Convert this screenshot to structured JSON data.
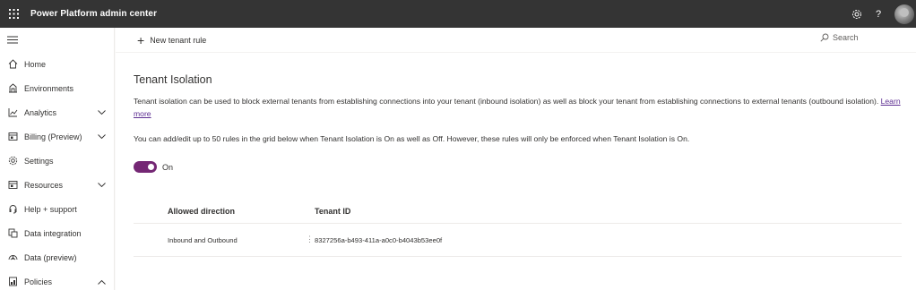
{
  "app": {
    "title": "Power Platform admin center",
    "icons": [
      "waffle-icon",
      "gear-icon",
      "help-icon",
      "avatar"
    ]
  },
  "sidebar": {
    "items": [
      {
        "label": "Home",
        "icon": "home-icon",
        "chevron": null
      },
      {
        "label": "Environments",
        "icon": "environments-icon",
        "chevron": null
      },
      {
        "label": "Analytics",
        "icon": "analytics-icon",
        "chevron": "down"
      },
      {
        "label": "Billing (Preview)",
        "icon": "billing-icon",
        "chevron": "down"
      },
      {
        "label": "Settings",
        "icon": "gear-icon",
        "chevron": null
      },
      {
        "label": "Resources",
        "icon": "resources-icon",
        "chevron": "down"
      },
      {
        "label": "Help + support",
        "icon": "headset-icon",
        "chevron": null
      },
      {
        "label": "Data integration",
        "icon": "data-integration-icon",
        "chevron": null
      },
      {
        "label": "Data (preview)",
        "icon": "data-preview-icon",
        "chevron": null
      },
      {
        "label": "Policies",
        "icon": "policies-icon",
        "chevron": "up"
      }
    ]
  },
  "commandbar": {
    "new_rule_label": "New tenant rule",
    "search_label": "Search"
  },
  "main": {
    "title": "Tenant Isolation",
    "description": "Tenant isolation can be used to block external tenants from establishing connections into your tenant (inbound isolation) as well as block your tenant from establishing connections to external tenants (outbound isolation).",
    "learn_more": "Learn more",
    "note": "You can add/edit up to 50 rules in the grid below when Tenant Isolation is On as well as Off. However, these rules will only be enforced when Tenant Isolation is On.",
    "toggle": {
      "state": "On",
      "color": "#742774"
    }
  },
  "grid": {
    "headers": {
      "direction": "Allowed direction",
      "tenant_id": "Tenant ID"
    },
    "rows": [
      {
        "direction": "Inbound and Outbound",
        "more": "⋮",
        "tenant_id": "8327256a-b493-411a-a0c0-b4043b53ee0f"
      }
    ]
  }
}
